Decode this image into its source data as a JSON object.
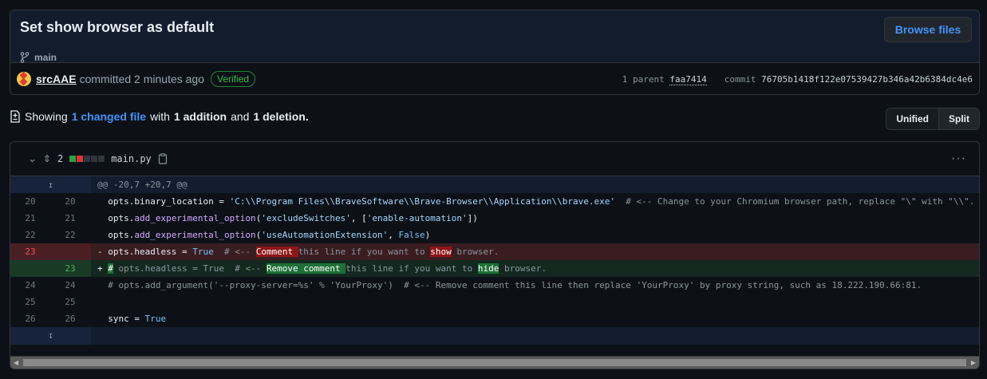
{
  "commit": {
    "title": "Set show browser as default",
    "branch": "main",
    "browse_label": "Browse files",
    "author": "srcAAE",
    "committed_text": "committed 2 minutes ago",
    "verified": "Verified",
    "parent_label": "1 parent",
    "parent_sha": "faa7414",
    "commit_label": "commit",
    "commit_sha": "76705b1418f122e07539427b346a42b6384dc4e6"
  },
  "summary": {
    "showing": "Showing",
    "changed": "1 changed file",
    "with": "with",
    "additions": "1 addition",
    "and": "and",
    "deletions": "1 deletion",
    "period": "."
  },
  "view_toggle": {
    "unified": "Unified",
    "split": "Split"
  },
  "file": {
    "changes": "2",
    "name": "main.py",
    "more": "···"
  },
  "diff": {
    "hunk": "@@ -20,7 +20,7 @@",
    "lines": [
      {
        "type": "ctx",
        "old": "20",
        "new": "20",
        "segs": [
          [
            "",
            "  opts.binary_location = "
          ],
          [
            "s",
            "'C:\\\\Program Files\\\\BraveSoftware\\\\Brave-Browser\\\\Application\\\\brave.exe'"
          ],
          [
            "c",
            "  # <-- Change to your Chromium browser path, replace \"\\\" with \"\\\\\"."
          ]
        ]
      },
      {
        "type": "ctx",
        "old": "21",
        "new": "21",
        "segs": [
          [
            "",
            "  opts."
          ],
          [
            "f",
            "add_experimental_option"
          ],
          [
            "",
            "("
          ],
          [
            "s",
            "'excludeSwitches'"
          ],
          [
            "",
            ", ["
          ],
          [
            "s",
            "'enable-automation'"
          ],
          [
            "",
            "])"
          ]
        ]
      },
      {
        "type": "ctx",
        "old": "22",
        "new": "22",
        "segs": [
          [
            "",
            "  opts."
          ],
          [
            "f",
            "add_experimental_option"
          ],
          [
            "",
            "("
          ],
          [
            "s",
            "'useAutomationExtension'"
          ],
          [
            "",
            ", "
          ],
          [
            "k",
            "False"
          ],
          [
            "",
            ")"
          ]
        ]
      },
      {
        "type": "del",
        "old": "23",
        "new": "",
        "segs": [
          [
            "",
            "- opts.headless = "
          ],
          [
            "k",
            "True"
          ],
          [
            "c",
            "  # <-- "
          ],
          [
            "hd",
            "Comment "
          ],
          [
            "c",
            "this line if you want to "
          ],
          [
            "hd",
            "show"
          ],
          [
            "c",
            " browser."
          ]
        ]
      },
      {
        "type": "add",
        "old": "",
        "new": "23",
        "segs": [
          [
            "",
            "+ "
          ],
          [
            "ha",
            "#"
          ],
          [
            "c",
            " opts.headless = True  # <-- "
          ],
          [
            "ha",
            "Remove comment "
          ],
          [
            "c",
            "this line if you want to "
          ],
          [
            "ha",
            "hide"
          ],
          [
            "c",
            " browser."
          ]
        ]
      },
      {
        "type": "ctx",
        "old": "24",
        "new": "24",
        "segs": [
          [
            "c",
            "  # opts.add_argument('--proxy-server=%s' % 'YourProxy')  # <-- Remove comment this line then replace 'YourProxy' by proxy string, such as 18.222.190.66:81."
          ]
        ]
      },
      {
        "type": "ctx",
        "old": "25",
        "new": "25",
        "segs": [
          [
            "",
            ""
          ]
        ]
      },
      {
        "type": "ctx",
        "old": "26",
        "new": "26",
        "segs": [
          [
            "",
            "  sync = "
          ],
          [
            "k",
            "True"
          ]
        ]
      }
    ]
  }
}
